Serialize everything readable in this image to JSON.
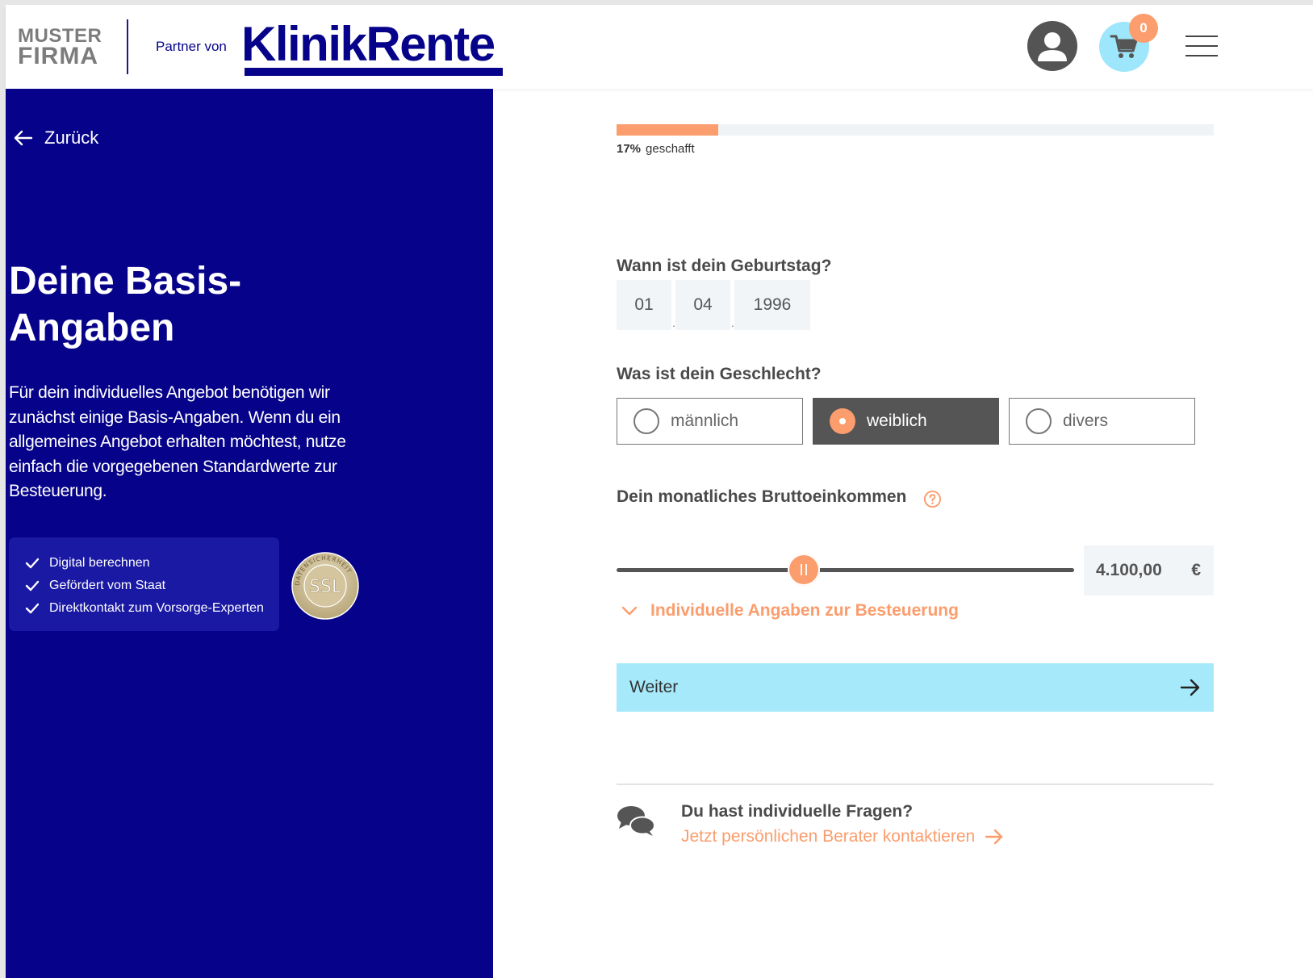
{
  "header": {
    "logo_line1": "MUSTER",
    "logo_line2": "FIRMA",
    "partner_label": "Partner von",
    "brand": "KlinikRente",
    "cart_count": "0"
  },
  "sidebar": {
    "back_label": "Zurück",
    "title_line1": "Deine Basis-",
    "title_line2": "Angaben",
    "intro_text": "Für dein individuelles Angebot benötigen wir zunächst einige Basis-Angaben. Wenn du ein allgemeines Angebot erhalten möchtest, nutze einfach die vorgegebenen Standardwerte zur Besteuerung.",
    "features": [
      "Digital berechnen",
      "Gefördert vom Staat",
      "Direktkontakt zum Vorsorge-Experten"
    ],
    "ssl_label": "SSL",
    "ssl_ring_text": "DATENSICHERHEIT"
  },
  "progress": {
    "percent": 17,
    "percent_label": "17%",
    "suffix": "geschafft"
  },
  "form": {
    "birthday_label": "Wann ist dein Geburtstag?",
    "birthday": {
      "day": "01",
      "month": "04",
      "year": "1996"
    },
    "gender_label": "Was ist dein Geschlecht?",
    "gender_options": [
      "männlich",
      "weiblich",
      "divers"
    ],
    "gender_selected": "weiblich",
    "income_label": "Dein monatliches Bruttoeinkommen",
    "income_value": "4.100,00",
    "income_currency": "€",
    "income_slider_fraction": 0.41,
    "tax_toggle_label": "Individuelle Angaben zur Besteuerung",
    "next_label": "Weiter"
  },
  "contact": {
    "title": "Du hast individuelle Fragen?",
    "link_label": "Jetzt persönlichen Berater kontaktieren"
  },
  "colors": {
    "brand_blue": "#06038a",
    "accent_orange": "#fb9d6d",
    "light_cyan": "#a5e9fb",
    "dark_gray": "#555555"
  }
}
